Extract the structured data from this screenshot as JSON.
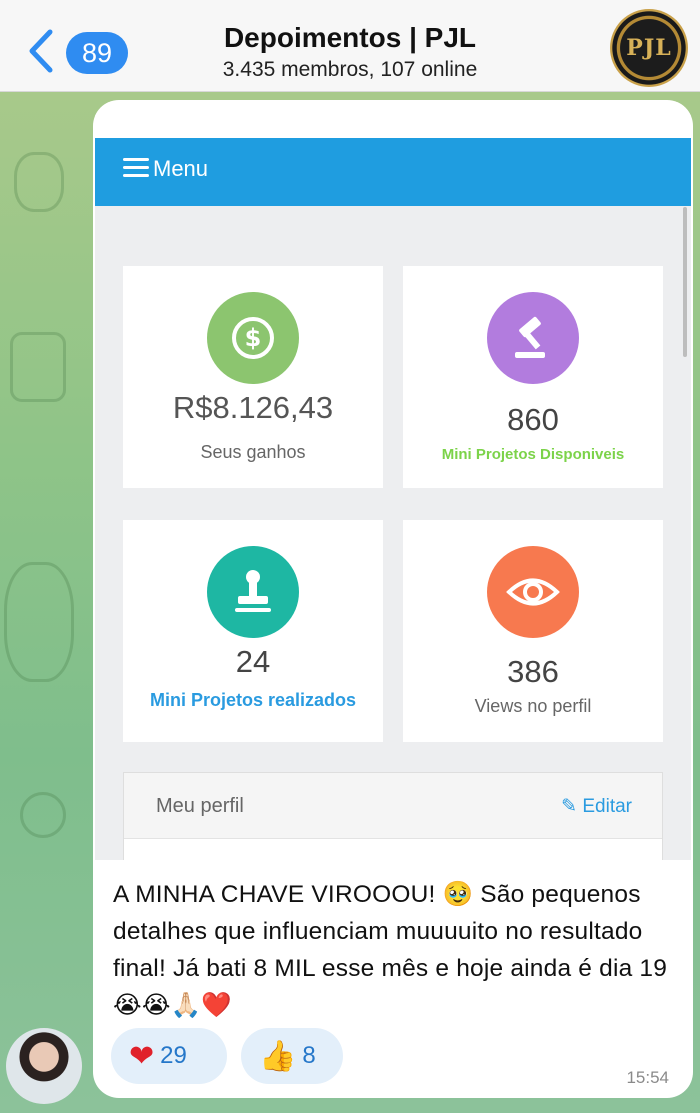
{
  "header": {
    "back_count": "89",
    "title": "Depoimentos | PJL",
    "subtitle": "3.435 membros, 107 online",
    "avatar_text": "PJL"
  },
  "screenshot": {
    "menu_label": "Menu",
    "cards": [
      {
        "value": "R$8.126,43",
        "label": "Seus ganhos",
        "icon": "dollar-icon",
        "color": "#8cc56f",
        "label_color": "#666666"
      },
      {
        "value": "860",
        "label": "Mini Projetos Disponiveis",
        "icon": "gavel-icon",
        "color": "#b27cde",
        "label_color": "#7cd34a"
      },
      {
        "value": "24",
        "label": "Mini Projetos realizados",
        "icon": "stamp-icon",
        "color": "#1eb7a3",
        "label_color": "#2a9be0"
      },
      {
        "value": "386",
        "label": "Views no perfil",
        "icon": "eye-icon",
        "color": "#f7794f",
        "label_color": "#666666"
      }
    ],
    "profile_title": "Meu perfil",
    "edit_label": "Editar"
  },
  "message": {
    "text": "A MINHA CHAVE VIROOOU! 🥹 São pequenos detalhes que influenciam muuuuito no resultado final! Já bati 8 MIL esse mês e hoje ainda é dia 19 😭😭🙏🏻❤️",
    "time": "15:54",
    "reactions": [
      {
        "emoji": "❤️",
        "count": "29",
        "icon": "heart-icon"
      },
      {
        "emoji": "👍",
        "count": "8",
        "icon": "thumbs-up-icon"
      }
    ]
  }
}
